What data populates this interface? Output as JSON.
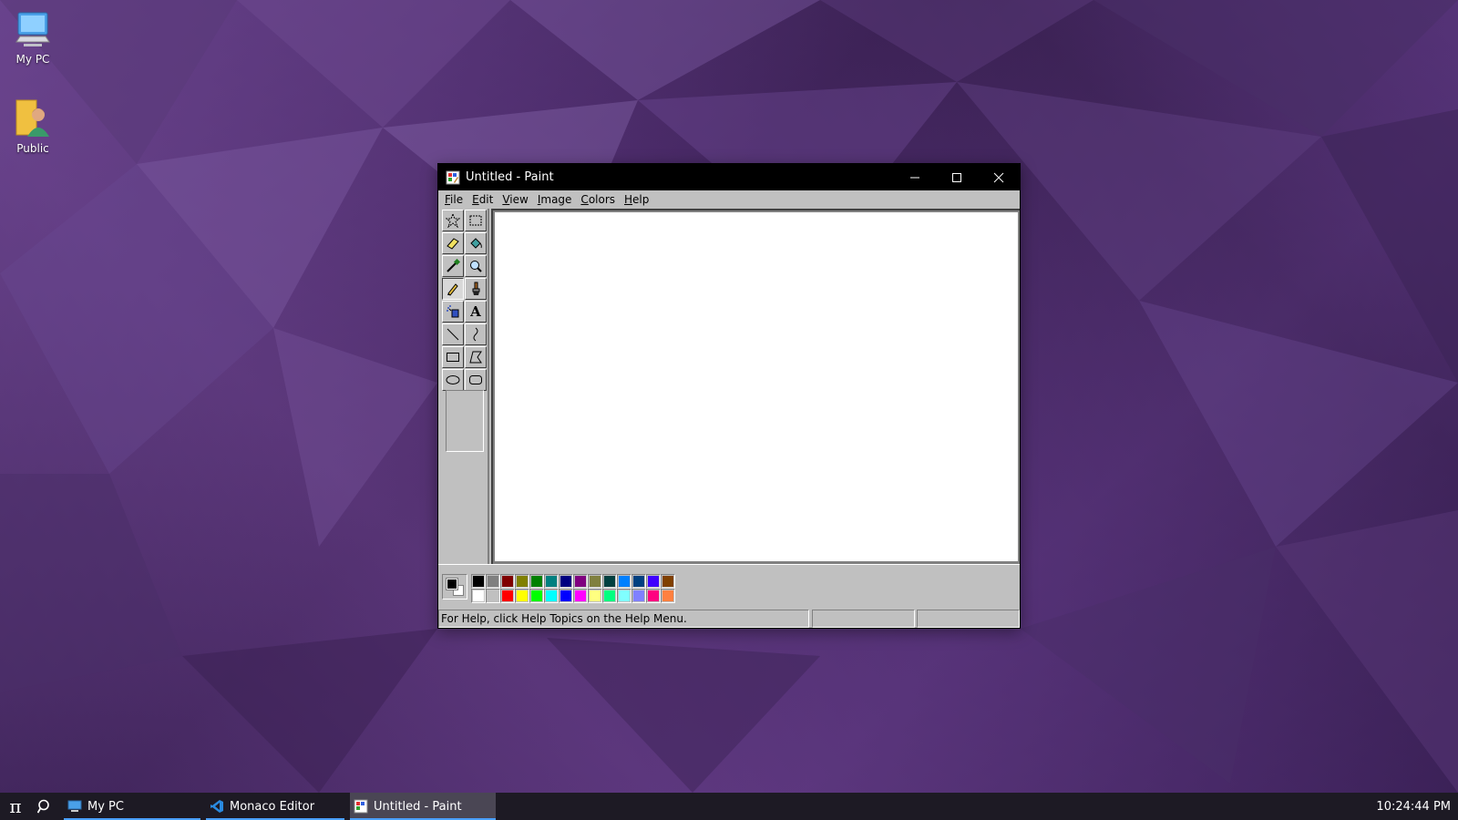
{
  "desktop": {
    "icons": [
      {
        "label": "My PC",
        "icon": "computer-icon"
      },
      {
        "label": "Public",
        "icon": "user-folder-icon"
      }
    ]
  },
  "window": {
    "title": "Untitled - Paint",
    "app_icon": "paint-icon",
    "controls": {
      "minimize": "─",
      "maximize": "☐",
      "close": "✕"
    },
    "menu": [
      {
        "label": "File",
        "key": "F",
        "rest": "ile"
      },
      {
        "label": "Edit",
        "key": "E",
        "rest": "dit"
      },
      {
        "label": "View",
        "key": "V",
        "rest": "iew"
      },
      {
        "label": "Image",
        "key": "I",
        "rest": "mage"
      },
      {
        "label": "Colors",
        "key": "C",
        "rest": "olors"
      },
      {
        "label": "Help",
        "key": "H",
        "rest": "elp"
      }
    ],
    "tools": [
      "free-form-select-icon",
      "select-icon",
      "eraser-icon",
      "fill-bucket-icon",
      "pick-color-icon",
      "magnifier-icon",
      "pencil-icon",
      "brush-icon",
      "airbrush-icon",
      "text-icon",
      "line-icon",
      "curve-icon",
      "rectangle-icon",
      "polygon-icon",
      "ellipse-icon",
      "rounded-rectangle-icon"
    ],
    "active_tool": "pencil-icon",
    "text_tool_glyph": "A",
    "foreground_color": "#000000",
    "background_color": "#ffffff",
    "palette": {
      "row1": [
        "#000000",
        "#808080",
        "#800000",
        "#808000",
        "#008000",
        "#008080",
        "#000080",
        "#800080",
        "#808040",
        "#004040",
        "#0080ff",
        "#004080",
        "#4000ff",
        "#804000"
      ],
      "row2": [
        "#ffffff",
        "#c0c0c0",
        "#ff0000",
        "#ffff00",
        "#00ff00",
        "#00ffff",
        "#0000ff",
        "#ff00ff",
        "#ffff80",
        "#00ff80",
        "#80ffff",
        "#8080ff",
        "#ff0080",
        "#ff8040"
      ]
    },
    "status": {
      "help_text": "For Help, click Help Topics on the Help Menu.",
      "coords": "",
      "size": ""
    }
  },
  "taskbar": {
    "start_glyph": "π",
    "tasks": [
      {
        "label": "My PC",
        "icon": "computer-icon"
      },
      {
        "label": "Monaco Editor",
        "icon": "vscode-icon"
      },
      {
        "label": "Untitled - Paint",
        "icon": "paint-icon"
      }
    ],
    "clock": "10:24:44 PM",
    "accent": "#4aa0ff"
  }
}
